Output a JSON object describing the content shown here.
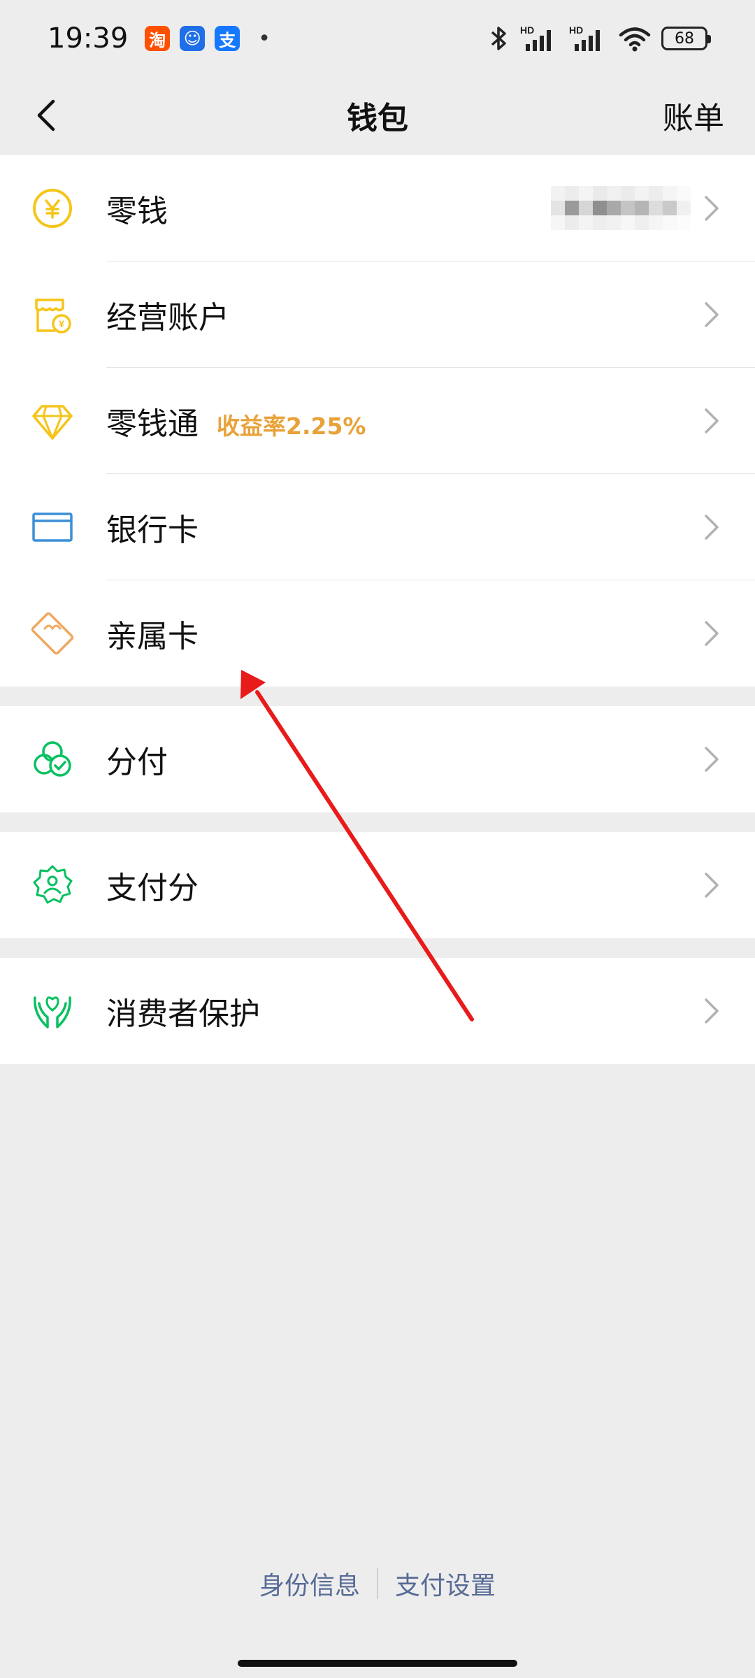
{
  "status_bar": {
    "time": "19:39",
    "apps": [
      {
        "name": "taobao-icon",
        "glyph": "淘",
        "color": "#ff5000"
      },
      {
        "name": "chat-app-icon",
        "glyph": "☺",
        "color": "#1e6fe8"
      },
      {
        "name": "alipay-icon",
        "glyph": "支",
        "color": "#1677ff"
      }
    ],
    "dot": "•",
    "hd1": "HD",
    "hd2": "HD",
    "battery": "68"
  },
  "nav": {
    "title": "钱包",
    "bill_label": "账单"
  },
  "menu": {
    "change": {
      "label": "零钱"
    },
    "business": {
      "label": "经营账户"
    },
    "lqt": {
      "label": "零钱通",
      "tag": "收益率2.25%"
    },
    "bank_card": {
      "label": "银行卡"
    },
    "family_card": {
      "label": "亲属卡"
    },
    "installment": {
      "label": "分付"
    },
    "pay_score": {
      "label": "支付分"
    },
    "consumer_protection": {
      "label": "消费者保护"
    }
  },
  "footer": {
    "identity": "身份信息",
    "settings": "支付设置"
  },
  "colors": {
    "accent_yellow": "#f5c518",
    "accent_green": "#07c160",
    "accent_blue": "#3a8fd6",
    "accent_orange": "#e8a238",
    "link_blue": "#576b95",
    "annotation_red": "#e81b1b"
  }
}
